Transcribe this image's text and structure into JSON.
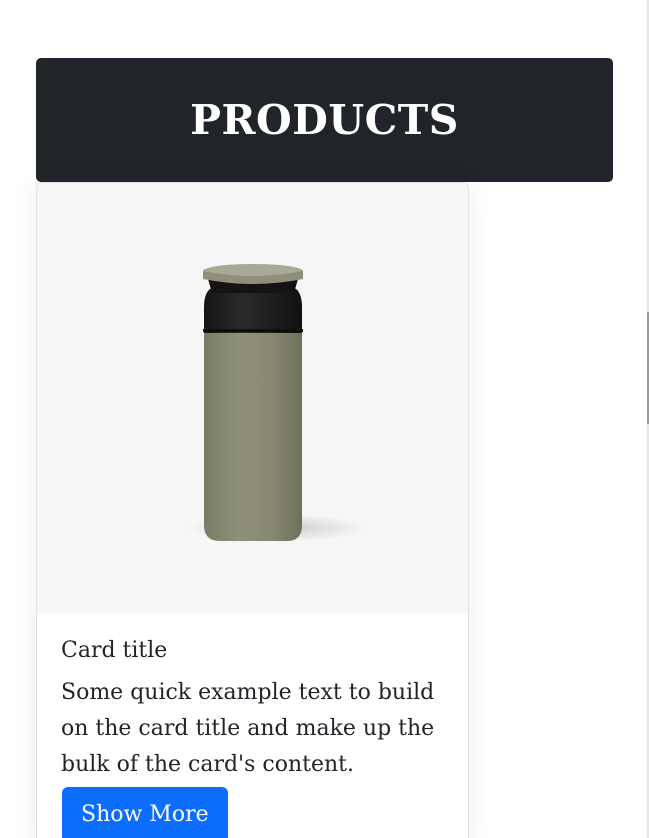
{
  "header": {
    "title": "PRODUCTS"
  },
  "card": {
    "image_alt": "Olive green insulated travel tumbler with black lid",
    "title": "Card title",
    "text": "Some quick example text to build on the card title and make up the bulk of the card's content.",
    "button_label": "Show More"
  },
  "colors": {
    "header_bg": "#212529",
    "button_bg": "#0d6efd",
    "tumbler_body": "#8a8b73",
    "tumbler_lid": "#1f1f1f"
  }
}
